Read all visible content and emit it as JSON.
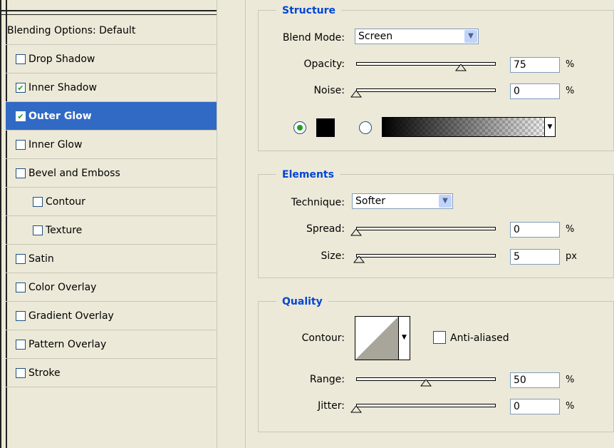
{
  "styles_panel": {
    "header": "Blending Options: Default",
    "items": [
      {
        "label": "Drop Shadow",
        "checked": false,
        "selected": false,
        "sub": false
      },
      {
        "label": "Inner Shadow",
        "checked": true,
        "selected": false,
        "sub": false
      },
      {
        "label": "Outer Glow",
        "checked": true,
        "selected": true,
        "sub": false
      },
      {
        "label": "Inner Glow",
        "checked": false,
        "selected": false,
        "sub": false
      },
      {
        "label": "Bevel and Emboss",
        "checked": false,
        "selected": false,
        "sub": false
      },
      {
        "label": "Contour",
        "checked": false,
        "selected": false,
        "sub": true
      },
      {
        "label": "Texture",
        "checked": false,
        "selected": false,
        "sub": true
      },
      {
        "label": "Satin",
        "checked": false,
        "selected": false,
        "sub": false
      },
      {
        "label": "Color Overlay",
        "checked": false,
        "selected": false,
        "sub": false
      },
      {
        "label": "Gradient Overlay",
        "checked": false,
        "selected": false,
        "sub": false
      },
      {
        "label": "Pattern Overlay",
        "checked": false,
        "selected": false,
        "sub": false
      },
      {
        "label": "Stroke",
        "checked": false,
        "selected": false,
        "sub": false
      }
    ]
  },
  "structure": {
    "title": "Structure",
    "blend_mode_label": "Blend Mode:",
    "blend_mode_value": "Screen",
    "opacity_label": "Opacity:",
    "opacity_value": "75",
    "opacity_level": 75,
    "opacity_unit": "%",
    "noise_label": "Noise:",
    "noise_value": "0",
    "noise_level": 0,
    "noise_unit": "%",
    "color_mode": "solid",
    "glow_color": "#000000"
  },
  "elements": {
    "title": "Elements",
    "technique_label": "Technique:",
    "technique_value": "Softer",
    "spread_label": "Spread:",
    "spread_value": "0",
    "spread_level": 0,
    "spread_unit": "%",
    "size_label": "Size:",
    "size_value": "5",
    "size_level": 2,
    "size_unit": "px"
  },
  "quality": {
    "title": "Quality",
    "contour_label": "Contour:",
    "anti_aliased_label": "Anti-aliased",
    "anti_aliased_checked": false,
    "range_label": "Range:",
    "range_value": "50",
    "range_level": 50,
    "range_unit": "%",
    "jitter_label": "Jitter:",
    "jitter_value": "0",
    "jitter_level": 0,
    "jitter_unit": "%"
  },
  "colors": {
    "selection": "#316ac5",
    "panel_bg": "#ece9d8",
    "group_title": "#0046d5",
    "checkmark": "#21a121"
  }
}
